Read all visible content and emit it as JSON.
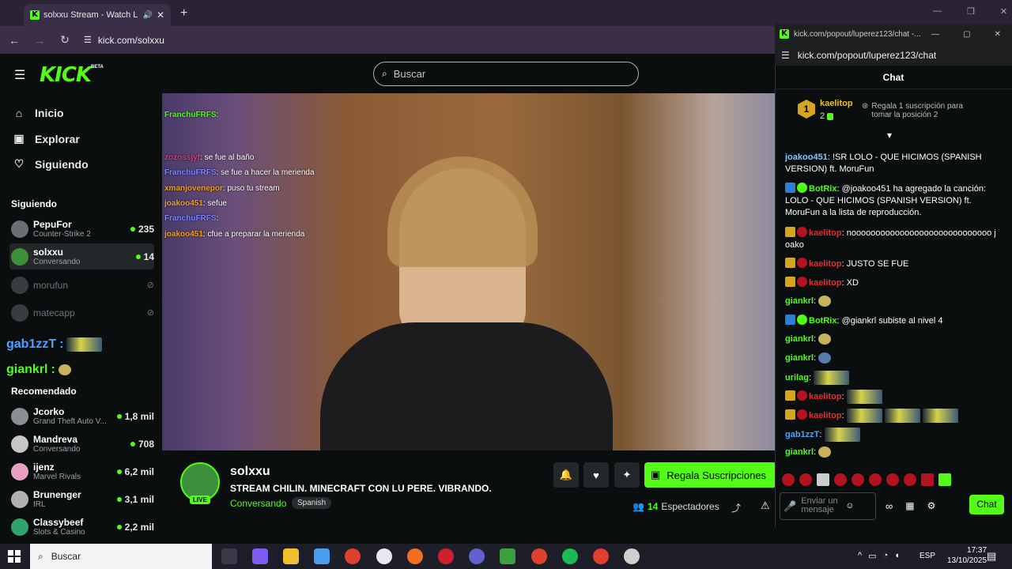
{
  "browser": {
    "tab_title": "solxxu Stream - Watch Live",
    "url": "kick.com/solxxu"
  },
  "header": {
    "logo": "KICK",
    "logo_tag": "BETA",
    "search_placeholder": "Buscar"
  },
  "sidebar": {
    "nav": [
      {
        "label": "Inicio",
        "icon": "home-icon"
      },
      {
        "label": "Explorar",
        "icon": "compass-icon"
      },
      {
        "label": "Siguiendo",
        "icon": "heart-icon"
      }
    ],
    "following_title": "Siguiendo",
    "following": [
      {
        "name": "PepuFor",
        "category": "Counter-Strike 2",
        "viewers": "235",
        "live": true
      },
      {
        "name": "solxxu",
        "category": "Conversando",
        "viewers": "14",
        "live": true
      },
      {
        "name": "morufun",
        "live": false
      },
      {
        "name": "matecapp",
        "live": false
      }
    ],
    "overlay_users": [
      "gab1zzT",
      "giankrl"
    ],
    "recommended_title": "Recomendado",
    "recommended": [
      {
        "name": "Jcorko",
        "category": "Grand Theft Auto V...",
        "viewers": "1,8 mil"
      },
      {
        "name": "Mandreva",
        "category": "Conversando",
        "viewers": "708"
      },
      {
        "name": "ijenz",
        "category": "Marvel Rivals",
        "viewers": "6,2 mil"
      },
      {
        "name": "Brunenger",
        "category": "IRL",
        "viewers": "3,1 mil"
      },
      {
        "name": "Classybeef",
        "category": "Slots & Casino",
        "viewers": "2,2 mil"
      }
    ]
  },
  "video_overlay_chat": [
    {
      "user": "FranchuFRFS",
      "text": ""
    },
    {
      "user": "zozossjyf",
      "text": "se fue al baño"
    },
    {
      "user": "FranchuFRFS",
      "text": "se fue a hacer la merienda"
    },
    {
      "user": "xmanjovenepor",
      "text": "puso tu stream"
    },
    {
      "user": "joakoo451",
      "text": "sefue"
    },
    {
      "user": "FranchuFRFS",
      "text": ""
    },
    {
      "user": "joakoo451",
      "text": "cfue a preparar la merienda"
    }
  ],
  "channel": {
    "name": "solxxu",
    "live_badge": "LIVE",
    "title": "STREAM CHILIN. MINECRAFT CON LU PERE. VIBRANDO.",
    "category": "Conversando",
    "language": "Spanish",
    "gift_label": "Regala Suscripciones",
    "viewers": "14",
    "viewers_label": "Espectadores"
  },
  "popout": {
    "window_title": "kick.com/popout/luperez123/chat -...",
    "url": "kick.com/popout/luperez123/chat",
    "chat_title": "Chat",
    "pinned": {
      "rank": "1",
      "user": "kaelitop",
      "count": "2",
      "text": "Regala 1 suscripción para tomar la posición 2"
    },
    "messages": [
      {
        "user": "joakoo451",
        "color": "#7ec8ff",
        "text": "!SR LOLO - QUE HICIMOS (SPANISH VERSION) ft. MoruFun"
      },
      {
        "user": "BotRix",
        "color": "#53fc18",
        "text": "@joakoo451 ha agregado la canción: LOLO - QUE HICIMOS (SPANISH VERSION) ft. MoruFun a la lista de reproducción."
      },
      {
        "user": "kaelitop",
        "color": "#e03030",
        "text": "nooooooooooooooooooooooooooooo joako"
      },
      {
        "user": "kaelitop",
        "color": "#e03030",
        "text": "JUSTO SE FUE"
      },
      {
        "user": "kaelitop",
        "color": "#e03030",
        "text": "XD"
      },
      {
        "user": "giankrl",
        "color": "#53fc18",
        "text": ""
      },
      {
        "user": "BotRix",
        "color": "#53fc18",
        "text": "@giankrl subiste al nivel 4"
      },
      {
        "user": "giankrl",
        "color": "#53fc18",
        "text": ""
      },
      {
        "user": "giankrl",
        "color": "#53fc18",
        "text": ""
      },
      {
        "user": "urilag",
        "color": "#53fc18",
        "text": ""
      },
      {
        "user": "kaelitop",
        "color": "#e03030",
        "text": ""
      },
      {
        "user": "kaelitop",
        "color": "#e03030",
        "text": ""
      },
      {
        "user": "gab1zzT",
        "color": "#4aa3ff",
        "text": ""
      },
      {
        "user": "giankrl",
        "color": "#53fc18",
        "text": ""
      }
    ],
    "input_placeholder": "Enviar un mensaje",
    "send_label": "Chat"
  },
  "taskbar": {
    "search_placeholder": "Buscar",
    "lang": "ESP",
    "time": "17:37",
    "date": "13/10/2025"
  },
  "colors": {
    "accent": "#53fc18",
    "bg": "#0b0e0f"
  }
}
